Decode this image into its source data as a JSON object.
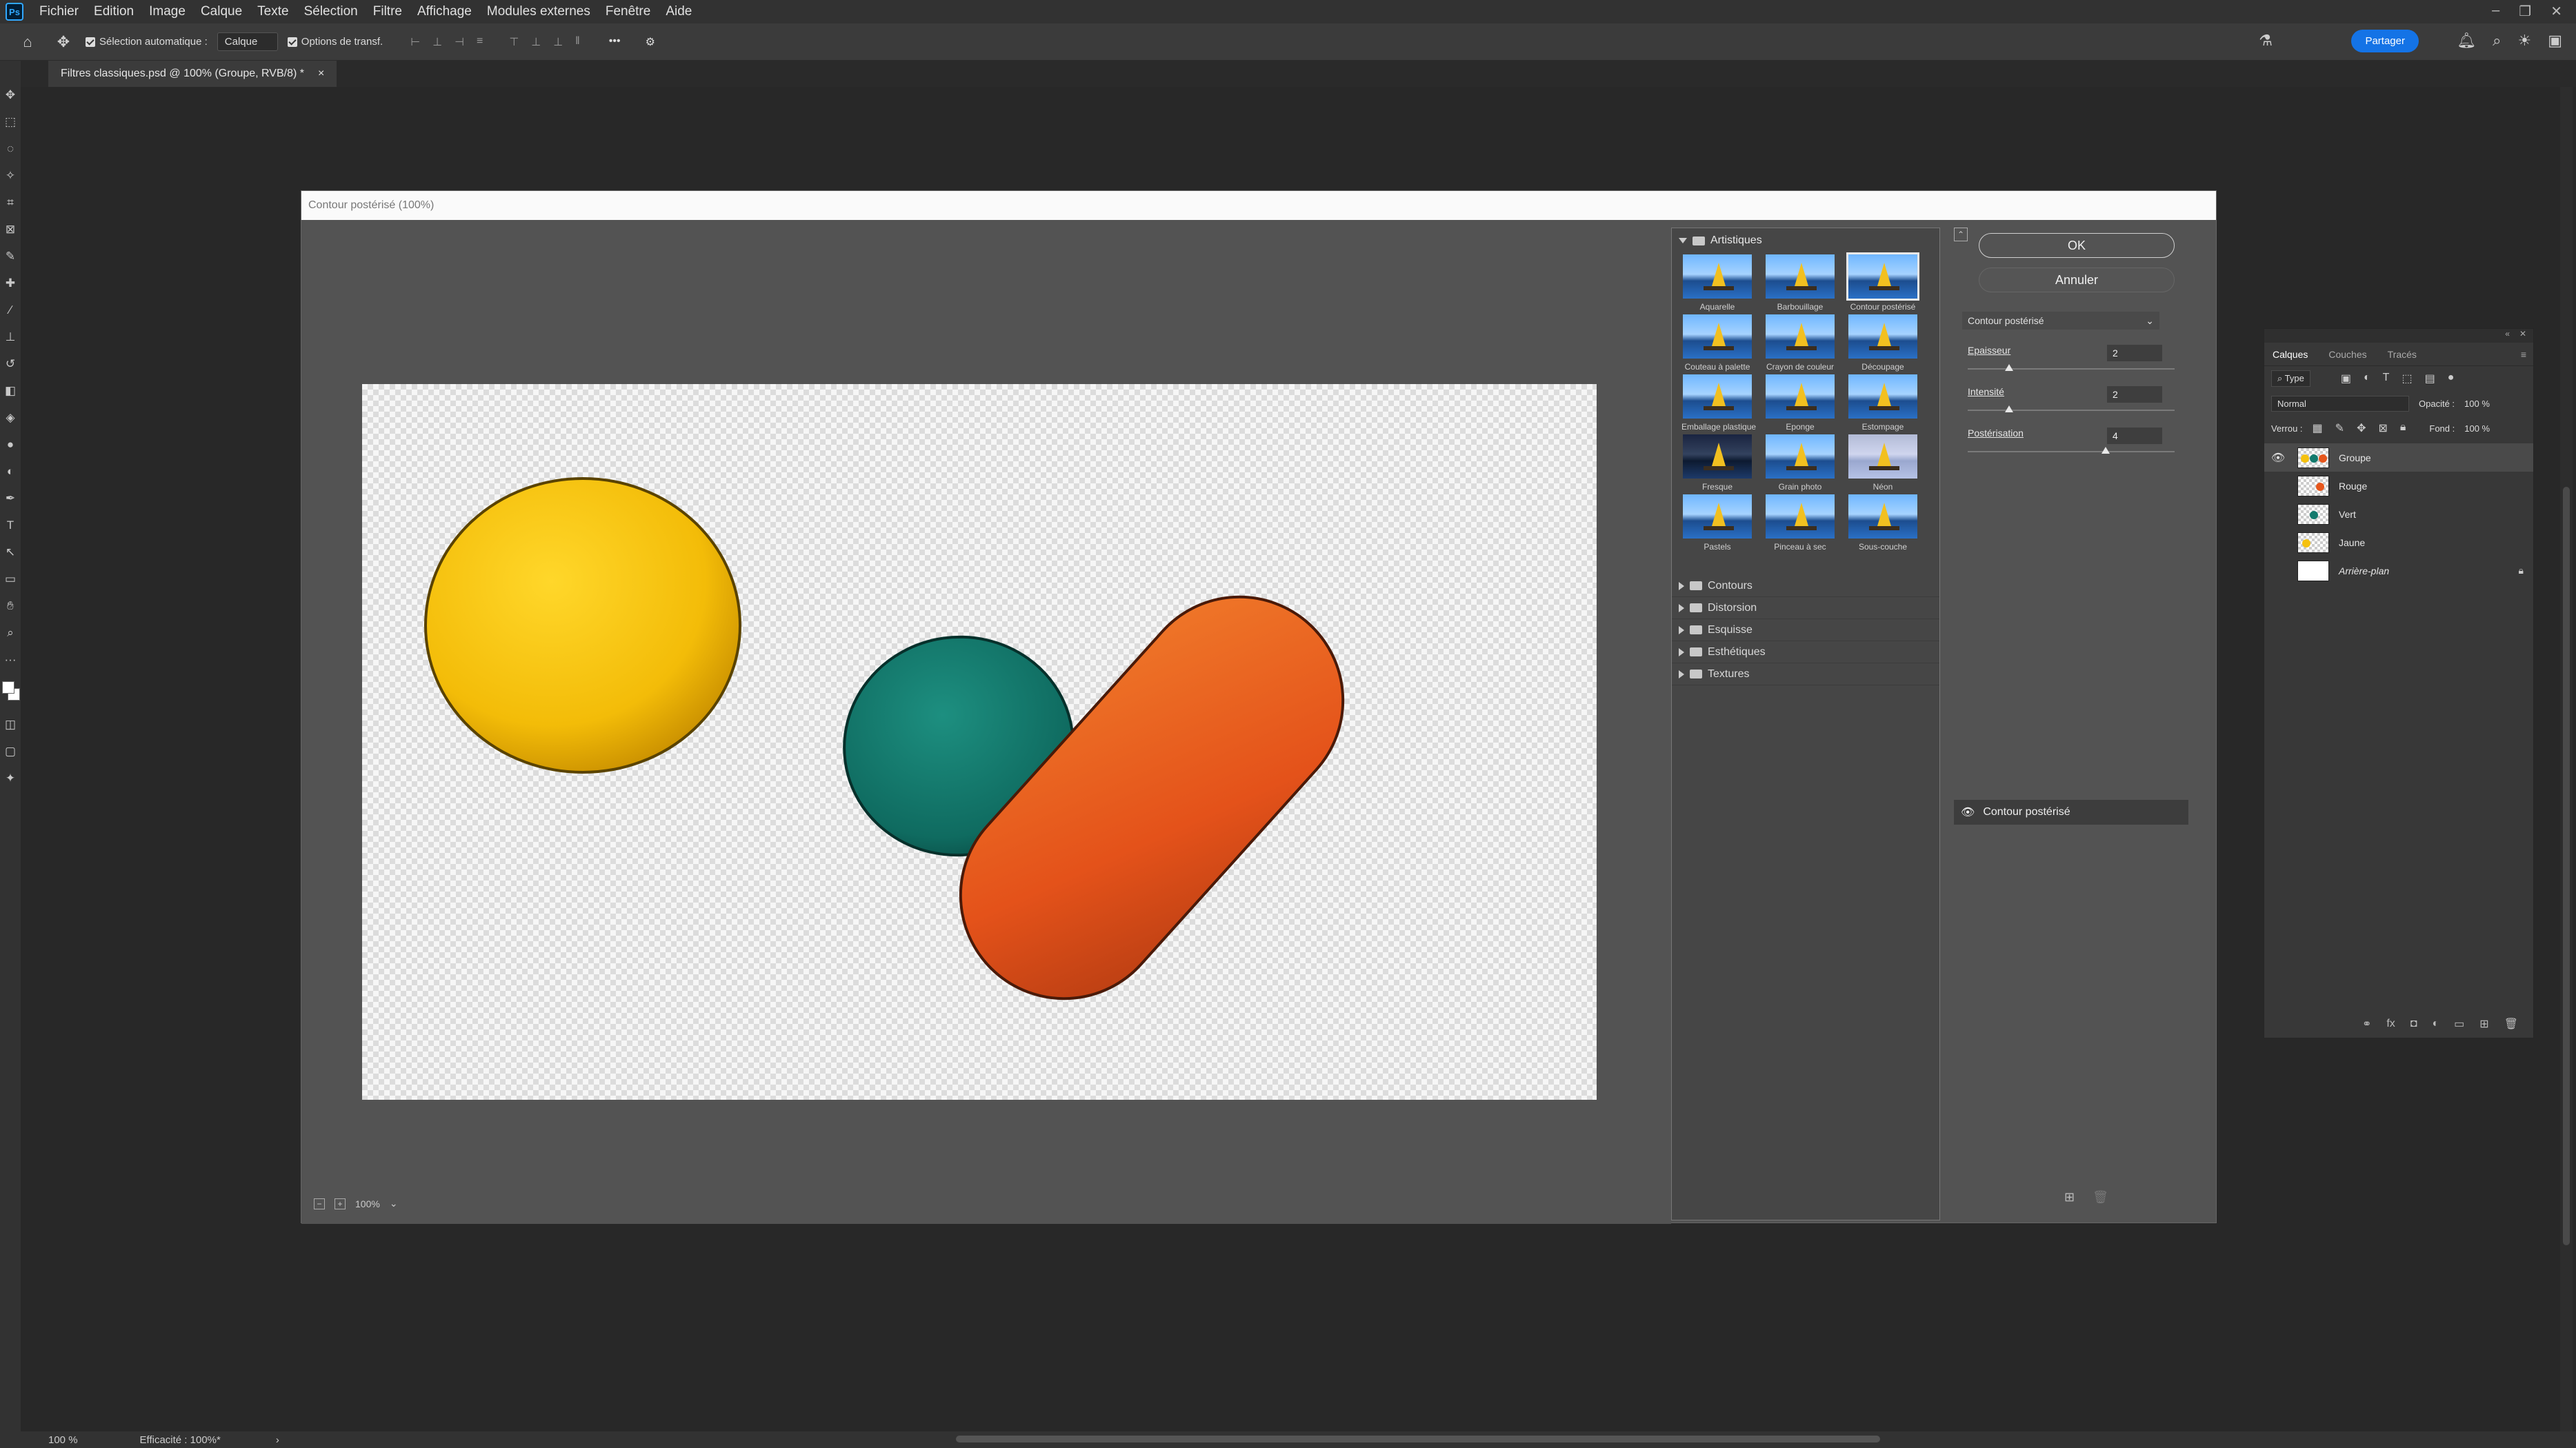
{
  "menubar": {
    "logo": "Ps",
    "items": [
      "Fichier",
      "Edition",
      "Image",
      "Calque",
      "Texte",
      "Sélection",
      "Filtre",
      "Affichage",
      "Modules externes",
      "Fenêtre",
      "Aide"
    ]
  },
  "optionsbar": {
    "auto_select_label": "Sélection automatique :",
    "auto_select_target": "Calque",
    "transform_label": "Options de transf.",
    "share_label": "Partager"
  },
  "document": {
    "tab_title": "Filtres classiques.psd @ 100% (Groupe, RVB/8) *",
    "tab_close": "×"
  },
  "dialog": {
    "title": "Contour postérisé (100%)",
    "zoom_value": "100%",
    "gallery": {
      "open_category": "Artistiques",
      "filters": [
        {
          "label": "Aquarelle",
          "style": "normal"
        },
        {
          "label": "Barbouillage",
          "style": "normal"
        },
        {
          "label": "Contour postérisé",
          "style": "selected"
        },
        {
          "label": "Couteau à palette",
          "style": "normal"
        },
        {
          "label": "Crayon de couleur",
          "style": "normal"
        },
        {
          "label": "Découpage",
          "style": "normal"
        },
        {
          "label": "Emballage plastique",
          "style": "normal"
        },
        {
          "label": "Eponge",
          "style": "normal"
        },
        {
          "label": "Estompage",
          "style": "normal"
        },
        {
          "label": "Fresque",
          "style": "dark"
        },
        {
          "label": "Grain photo",
          "style": "normal"
        },
        {
          "label": "Néon",
          "style": "pale"
        },
        {
          "label": "Pastels",
          "style": "normal"
        },
        {
          "label": "Pinceau à sec",
          "style": "normal"
        },
        {
          "label": "Sous-couche",
          "style": "normal"
        }
      ],
      "categories": [
        "Contours",
        "Distorsion",
        "Esquisse",
        "Esthétiques",
        "Textures"
      ]
    },
    "ok_label": "OK",
    "cancel_label": "Annuler",
    "selected_filter": "Contour postérisé",
    "params": [
      {
        "label": "Epaisseur",
        "value": "2",
        "min": 0,
        "max": 10
      },
      {
        "label": "Intensité",
        "value": "2",
        "min": 0,
        "max": 10
      },
      {
        "label": "Postérisation",
        "value": "4",
        "min": 0,
        "max": 6
      }
    ],
    "effect_layer_label": "Contour postérisé",
    "blob_colors": {
      "yellow": "#f5c10e",
      "teal": "#137a6d",
      "orange": "#e6561c"
    }
  },
  "layers_panel": {
    "tabs": [
      "Calques",
      "Couches",
      "Tracés"
    ],
    "filter_kind": "Type",
    "blend_mode": "Normal",
    "opacity_label": "Opacité :",
    "opacity_value": "100 %",
    "lock_label": "Verrou :",
    "fill_label": "Fond :",
    "fill_value": "100 %",
    "layers": [
      {
        "name": "Groupe",
        "visible": true,
        "selected": true
      },
      {
        "name": "Rouge",
        "visible": false,
        "selected": false
      },
      {
        "name": "Vert",
        "visible": false,
        "selected": false
      },
      {
        "name": "Jaune",
        "visible": false,
        "selected": false
      },
      {
        "name": "Arrière-plan",
        "visible": false,
        "selected": false
      }
    ]
  },
  "statusbar": {
    "zoom": "100 %",
    "efficiency": "Efficacité : 100%*"
  }
}
